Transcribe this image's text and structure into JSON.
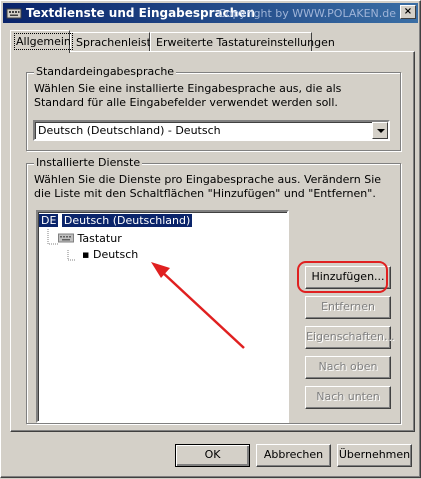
{
  "window": {
    "title": "Textdienste und Eingabesprachen",
    "copyright": "Copyright by WWW.POLAKEN.de",
    "close_glyph": "×"
  },
  "tabs": [
    {
      "label": "Allgemein",
      "active": true
    },
    {
      "label": "Sprachenleiste",
      "active": false
    },
    {
      "label": "Erweiterte Tastatureinstellungen",
      "active": false
    }
  ],
  "default_group": {
    "legend": "Standardeingabesprache",
    "description": "Wählen Sie eine installierte Eingabesprache aus, die als Standard für alle Eingabefelder verwendet werden soll.",
    "selected": "Deutsch (Deutschland) - Deutsch"
  },
  "services_group": {
    "legend": "Installierte Dienste",
    "description": "Wählen Sie die Dienste pro Eingabesprache aus. Verändern Sie die Liste mit den Schaltflächen \"Hinzufügen\" und \"Entfernen\".",
    "tree": {
      "lang_code": "DE",
      "lang_label": "Deutsch (Deutschland)",
      "category_label": "Tastatur",
      "item_label": "Deutsch",
      "bullet": "▪"
    },
    "buttons": {
      "add": "Hinzufügen...",
      "remove": "Entfernen",
      "properties": "Eigenschaften...",
      "up": "Nach oben",
      "down": "Nach unten"
    }
  },
  "footer": {
    "ok": "OK",
    "cancel": "Abbrechen",
    "apply": "Übernehmen"
  },
  "colors": {
    "annotation": "#e02020",
    "selection": "#0a246a"
  }
}
